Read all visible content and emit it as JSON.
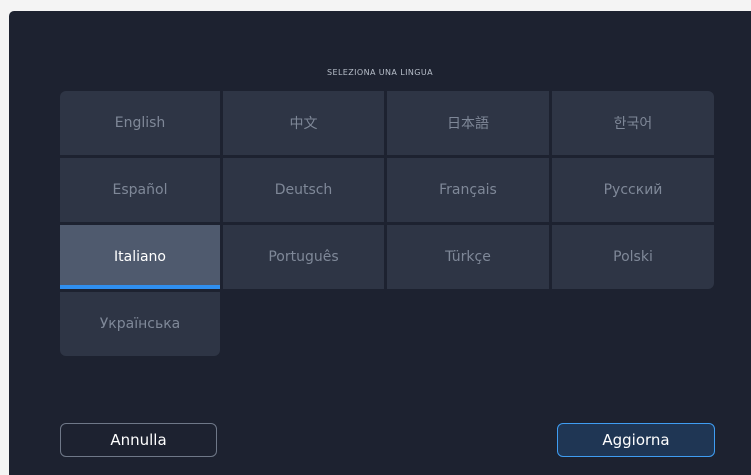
{
  "dialog": {
    "title": "SELEZIONA UNA LINGUA",
    "selected_language": "Italiano",
    "languages": [
      "English",
      "中文",
      "日本語",
      "한국어",
      "Español",
      "Deutsch",
      "Français",
      "Русский",
      "Italiano",
      "Português",
      "Türkçe",
      "Polski",
      "Українська"
    ],
    "cancel_label": "Annulla",
    "update_label": "Aggiorna"
  },
  "colors": {
    "background": "#1d2230",
    "tile": "#2e3545",
    "selected_tile": "#4f5a6e",
    "accent": "#2f8ff0"
  }
}
